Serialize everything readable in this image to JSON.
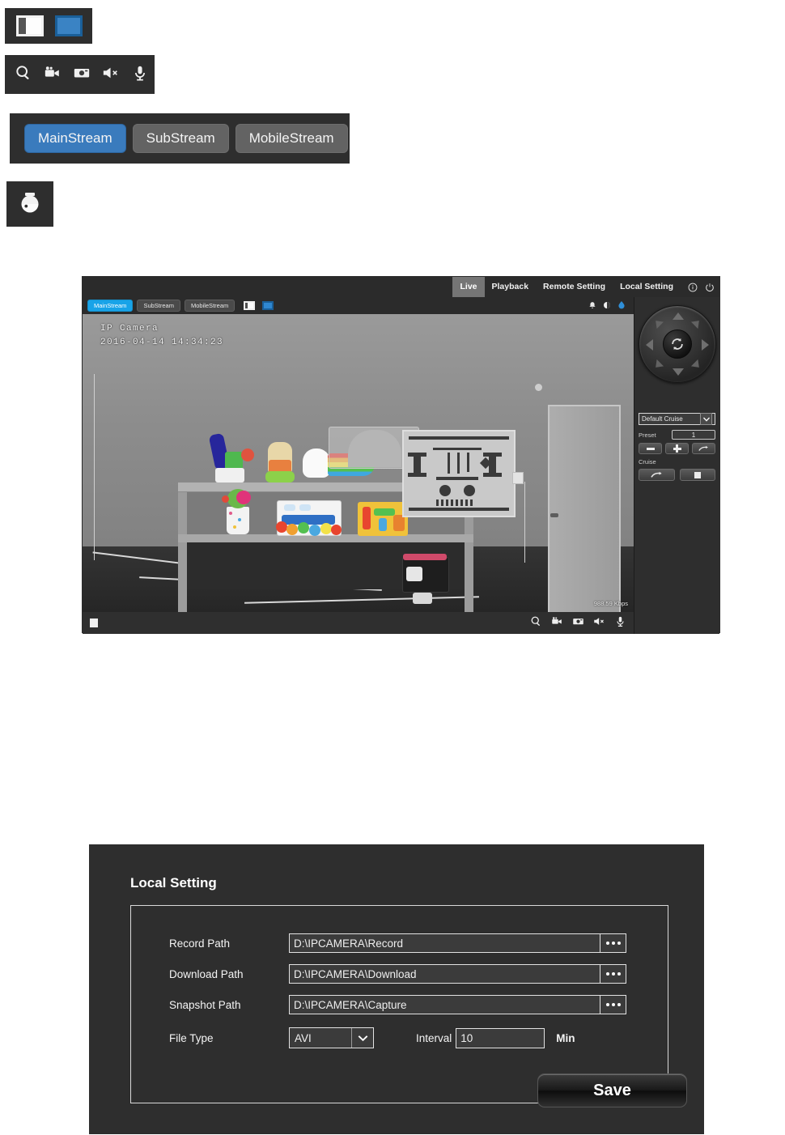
{
  "figures": {
    "view_mode_icons": [
      {
        "name": "split-view",
        "state": "inactive"
      },
      {
        "name": "full-view",
        "state": "active"
      }
    ],
    "media_icons": [
      "zoom-icon",
      "record-icon",
      "snapshot-icon",
      "speaker-mute-icon",
      "microphone-icon"
    ],
    "stream_buttons": [
      {
        "label": "MainStream",
        "active": true
      },
      {
        "label": "SubStream",
        "active": false
      },
      {
        "label": "MobileStream",
        "active": false
      }
    ],
    "dome_icon": "ptz-dome-camera-icon"
  },
  "app": {
    "topnav": {
      "items": [
        {
          "label": "Live",
          "active": true
        },
        {
          "label": "Playback",
          "active": false
        },
        {
          "label": "Remote Setting",
          "active": false
        },
        {
          "label": "Local Setting",
          "active": false
        }
      ],
      "icons": [
        "info-icon",
        "power-icon"
      ]
    },
    "streambar": {
      "buttons": [
        {
          "label": "MainStream",
          "active": true
        },
        {
          "label": "SubStream",
          "active": false
        },
        {
          "label": "MobileStream",
          "active": false
        }
      ],
      "right_icons": [
        "alarm-bell-icon",
        "color-adjust-icon",
        "water-drop-icon"
      ]
    },
    "video": {
      "osd_title": "IP Camera",
      "osd_timestamp": "2016-04-14 14:34:23",
      "bitrate": "988.59 Kbps"
    },
    "bottombar": {
      "stop_label": "",
      "icons": [
        "zoom-icon",
        "record-icon",
        "snapshot-icon",
        "speaker-mute-icon",
        "microphone-icon"
      ]
    },
    "ptz": {
      "cruise_select_value": "Default Cruise",
      "preset_label": "Preset",
      "preset_value": "1",
      "cruise_label": "Cruise",
      "preset_buttons": [
        "remove-preset",
        "add-preset",
        "goto-preset"
      ],
      "cruise_buttons": [
        "start-cruise",
        "stop-cruise"
      ]
    }
  },
  "local_setting": {
    "title": "Local Setting",
    "rows": [
      {
        "label": "Record Path",
        "value": "D:\\IPCAMERA\\Record"
      },
      {
        "label": "Download Path",
        "value": "D:\\IPCAMERA\\Download"
      },
      {
        "label": "Snapshot Path",
        "value": "D:\\IPCAMERA\\Capture"
      }
    ],
    "file_type_label": "File Type",
    "file_type_value": "AVI",
    "interval_label": "Interval",
    "interval_value": "10",
    "interval_unit": "Min",
    "save_label": "Save"
  },
  "colors": {
    "accent_blue": "#3a7bbd",
    "stream_active": "#18a3e8",
    "panel_bg": "#2e2e2e",
    "app_bg": "#2b2b2b"
  }
}
